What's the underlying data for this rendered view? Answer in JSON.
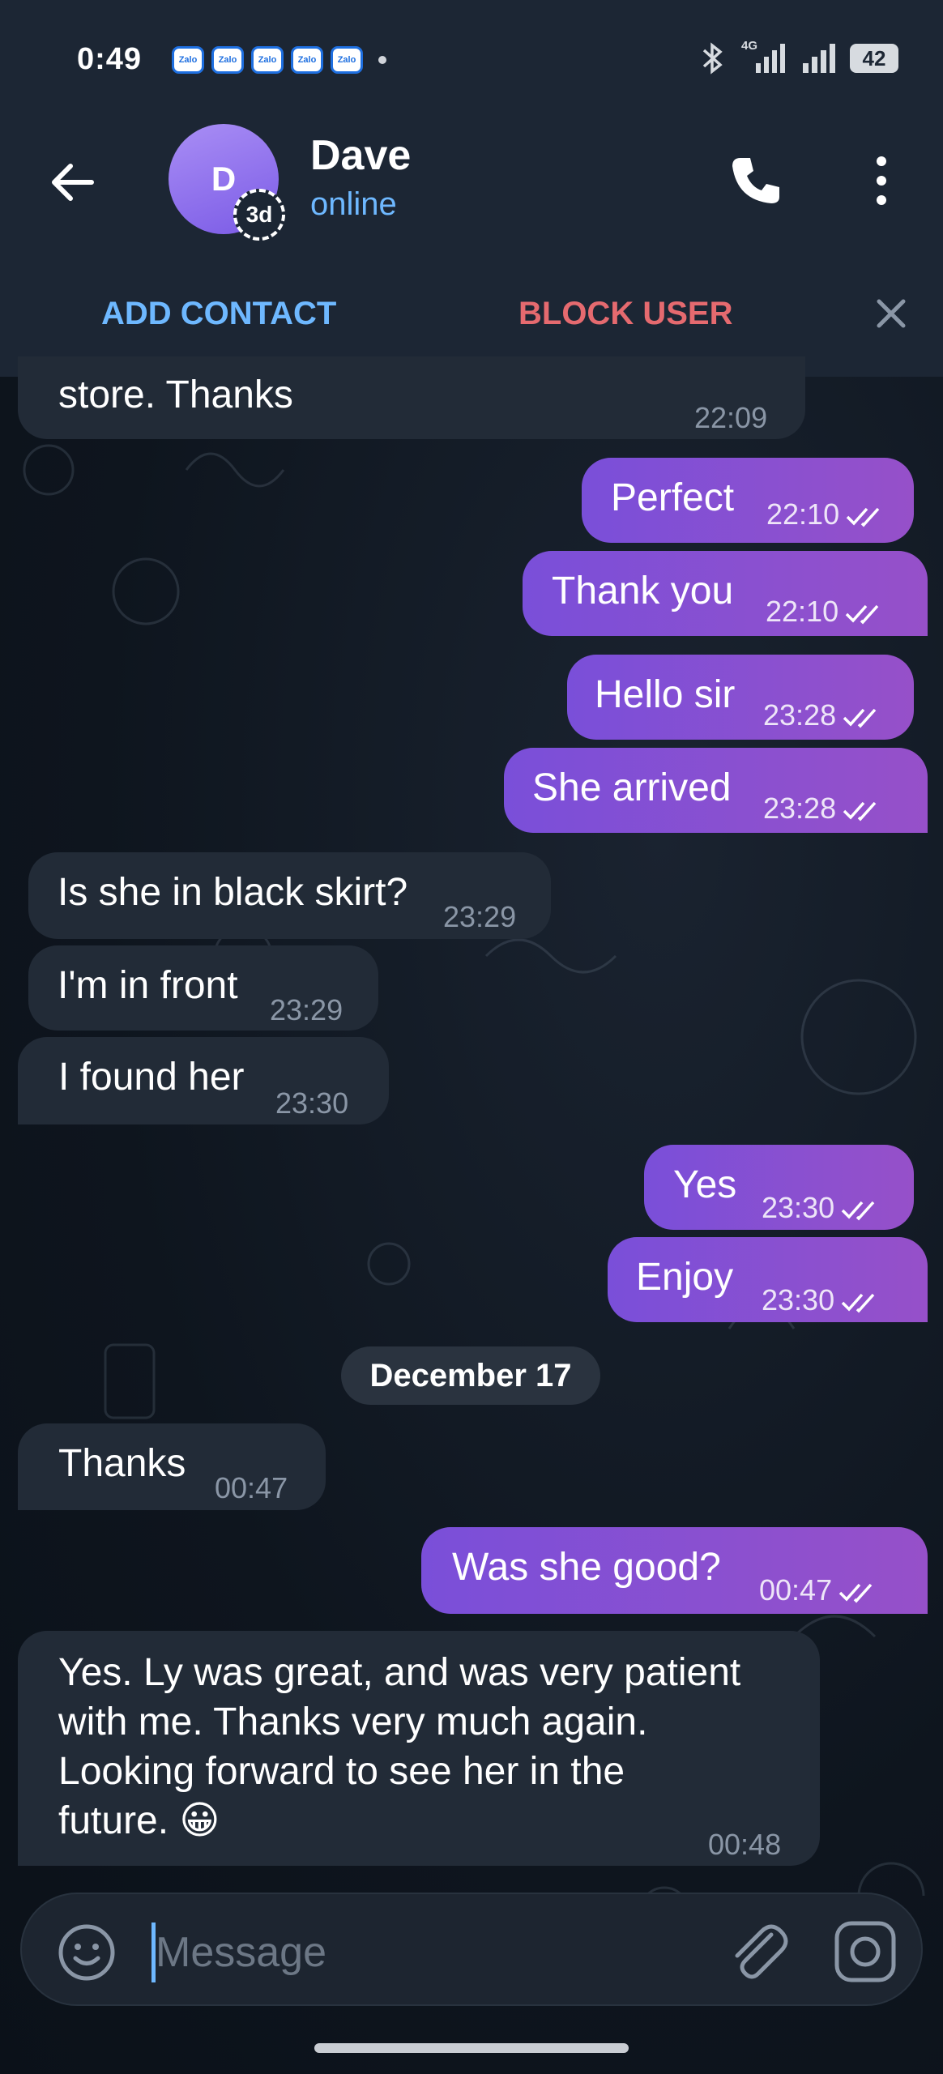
{
  "status_bar": {
    "time": "0:49",
    "notification_icons": [
      "Zalo",
      "Zalo",
      "Zalo",
      "Zalo",
      "Zalo"
    ],
    "network": "4G",
    "battery": "42"
  },
  "header": {
    "avatar_letter": "D",
    "story_badge": "3d",
    "contact_name": "Dave",
    "contact_status": "online"
  },
  "action_bar": {
    "add_contact": "ADD CONTACT",
    "block_user": "BLOCK USER"
  },
  "messages": [
    {
      "direction": "in",
      "text": "store. Thanks",
      "time": "22:09"
    },
    {
      "direction": "out",
      "text": "Perfect",
      "time": "22:10"
    },
    {
      "direction": "out",
      "text": "Thank you",
      "time": "22:10"
    },
    {
      "direction": "out",
      "text": "Hello sir",
      "time": "23:28"
    },
    {
      "direction": "out",
      "text": "She arrived",
      "time": "23:28"
    },
    {
      "direction": "in",
      "text": "Is she in black skirt?",
      "time": "23:29"
    },
    {
      "direction": "in",
      "text": "I'm in front",
      "time": "23:29"
    },
    {
      "direction": "in",
      "text": "I found her",
      "time": "23:30"
    },
    {
      "direction": "out",
      "text": "Yes",
      "time": "23:30"
    },
    {
      "direction": "out",
      "text": "Enjoy",
      "time": "23:30"
    },
    {
      "direction": "in",
      "text": "Thanks",
      "time": "00:47"
    },
    {
      "direction": "out",
      "text": "Was she good?",
      "time": "00:47"
    },
    {
      "direction": "in",
      "lines": [
        "Yes. Ly was great, and was very patient",
        "with me. Thanks very much again.",
        "Looking forward to see her in the",
        "future. 😀"
      ],
      "time": "00:48"
    }
  ],
  "date_separator": "December 17",
  "composer": {
    "placeholder": "Message"
  },
  "colors": {
    "background": "#0f1722",
    "header": "#1c2634",
    "incoming_bubble": "#222b37",
    "outgoing_bubble": "#8a4fd0",
    "link_blue": "#6eb8ff",
    "block_red": "#e56a6f"
  },
  "icons": [
    "back-arrow-icon",
    "phone-icon",
    "more-vertical-icon",
    "close-icon",
    "emoji-icon",
    "paperclip-icon",
    "camera-icon",
    "double-check-icon",
    "bluetooth-icon",
    "signal-icon"
  ]
}
